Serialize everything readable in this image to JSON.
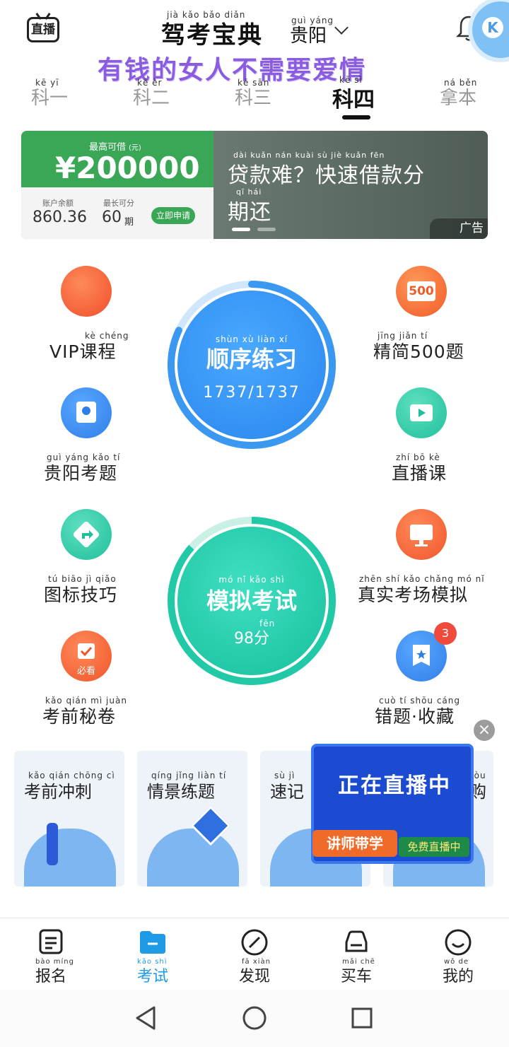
{
  "header": {
    "live_icon_label": "直播",
    "title": "驾考宝典",
    "title_pinyin": "jià kǎo bǎo diǎn",
    "city": "贵阳",
    "city_pinyin": "guì yáng",
    "slogan": "有钱的女人不需要爱情",
    "avatar_letter": "K"
  },
  "tabs": [
    {
      "label": "科一",
      "pinyin": "kē yī"
    },
    {
      "label": "科二",
      "pinyin": "kē èr"
    },
    {
      "label": "科三",
      "pinyin": "kē sān"
    },
    {
      "label": "科四",
      "pinyin": "kē sì",
      "active": true
    },
    {
      "label": "拿本",
      "pinyin": "ná běn"
    }
  ],
  "ad": {
    "max_label": "最高可借",
    "unit_label": "(元)",
    "amount": "¥200000",
    "balance_label": "账户余额",
    "balance_value": "860.36",
    "period_label": "最长可分",
    "period_value": "60",
    "period_unit": "期",
    "apply_button": "立即申请",
    "headline": "贷款难？快速借款分期还",
    "headline_line1": "贷款难？快速借款分",
    "headline_line2": "期还",
    "headline_pinyin1": "dài kuǎn nán    kuài sù  jiè kuǎn fēn",
    "headline_pinyin2": "qī  hái",
    "ad_badge": "广告"
  },
  "features": {
    "vip": {
      "label": "VIP课程",
      "pinyin": "kè chéng"
    },
    "jingjian": {
      "label": "精简500题",
      "pinyin": "jīng jiǎn           tí",
      "badge": "500"
    },
    "guiyang": {
      "label": "贵阳考题",
      "pinyin": "guì yáng kǎo  tí"
    },
    "zhibo": {
      "label": "直播课",
      "pinyin": "zhí  bō  kè"
    },
    "tubiao": {
      "label": "图标技巧",
      "pinyin": "tú biāo  jì  qiǎo"
    },
    "zhenshi": {
      "label": "真实考场模拟",
      "pinyin": "zhēn shí kǎo chǎng mó  nǐ"
    },
    "kaoqian": {
      "label": "考前秘卷",
      "pinyin": "kǎo qián  mì  juàn",
      "tag": "必看"
    },
    "cuoti": {
      "label": "错题·收藏",
      "pinyin": "cuò  tí    shōu cáng",
      "badge": "3"
    }
  },
  "practice": {
    "title": "顺序练习",
    "pinyin": "shùn xù liàn xí",
    "progress_text": "1737/1737",
    "progress": 1.0
  },
  "exam": {
    "title": "模拟考试",
    "pinyin": "mó  nǐ  kǎo shì",
    "score_text": "98分",
    "score_pinyin": "fēn"
  },
  "cards": [
    {
      "title": "考前冲刺",
      "pinyin": "kǎo qián chōng cì"
    },
    {
      "title": "情景练题",
      "pinyin": "qíng jǐng liàn tí"
    },
    {
      "title": "速记",
      "pinyin": "sù  jì"
    },
    {
      "title": "购",
      "pinyin": "gòu"
    }
  ],
  "popup": {
    "line1": "正在直播中",
    "tag1": "讲师带学",
    "tag2": "免费直播中"
  },
  "bottom_nav": [
    {
      "label": "报名",
      "pinyin": "bào míng"
    },
    {
      "label": "考试",
      "pinyin": "kǎo shì",
      "active": true
    },
    {
      "label": "发现",
      "pinyin": "fā  xiàn"
    },
    {
      "label": "买车",
      "pinyin": "mǎi chē"
    },
    {
      "label": "我的",
      "pinyin": "wǒ  de"
    }
  ],
  "colors": {
    "accent_blue": "#2f8cf0",
    "accent_teal": "#20c4a8",
    "ad_green": "#3aa757",
    "slogan_purple": "#8a5ce0",
    "nav_active": "#1e9be6"
  }
}
